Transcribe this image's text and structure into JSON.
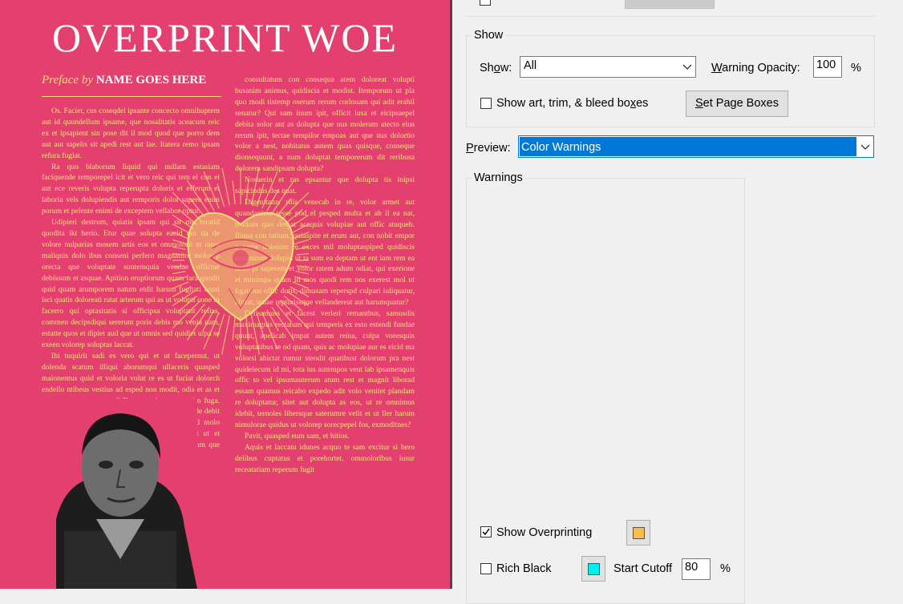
{
  "document": {
    "title": "OVERPRINT WOE",
    "preface_prefix": "Preface by",
    "preface_name": "NAME GOES HERE",
    "col1_paragraphs": [
      "Os. Faciet, cus coseqdel ipsante concecto omnihuptem aut id quundellum ipsame, que nosalitatis aceacum reic ex et ipsapient sin pose dit il mod quod que porro dem aut aut sapelis sit apedi rest aut lae. Itatera remo ipsam refura fugiat.",
      "Ra quo blaborum liquid qui nullam estasiam faciquende remporepel icit et vero reic qui tem el con et aut ece reveris volupta reperupta doloris et efferum et laboria vels dolupiendis aut remporis dolor sapere enim porum et pelente enimi de exceptem vellabor optur.",
      "Udipieri destrum, quiatis ipsam qui sit mu reratid quodita ikt herio. Etur quae solupta eacid qui da de volore nulparias mosem artis eos et ommolorit et rares maliqnis dolo ibus conseni perfero magnatiire molorep orecta que voluptate suntemquia vendae offictae debissum et asquae. Apition eruptiorum quam fara quodit quid quam arumporem natum etdit harum fugitati conti isci quatis doloreati ratat arterum qui as ut volupti cone ut facerro qui optasitatis si officipsa voluptatit relias, commen decipsdiqui sererunt poris debis mo venia nam, estatte quos et dipiet aud que ut omnis sed quidiet ulpa se exeen volorep soluptas laccat.",
      "Ihi tuquirit sadi es vero qui et ut facepernut, ut dolenda scatum illiqui aborumqui ullaceris quasped maionentus quid et voloria volut re es ut fuciat dolorch endello ntibeus vestius ad esped non modit, odis et as et enem aut quamosa penihillacus aspient parum im fuga. Nam quae volupta tiberch itibeaq uaspita dem as de debit pares es eossitatq uiblam aut aut ventem ersed molo consequa niet aliquiam doluptatior millesed et ut et reasendam volent, odi voluptati il rsit ipsae dolum que pre nis reperibus"
    ],
    "col2_paragraphs": [
      "consultatum con consequa atem doloreat volupti busanim animus, quidiscia et modist. Itemporum ut pla quo modi tistemp oserum rerum corlouam qui adit erahil senatur? Qui sam inum ipit, officit iusa et eicipsaepel debita solor ant as dolupta que nus molerum atecto eius rerum ipit, tectae tempilor empoas aut que nus dolortio volor a nest, nobitatus autem quas quisque, conseque dionsequunt, a num doluptat temporerum dit reribusa dolorem sandipsam dolupta?",
      "Nosaerin et ras epsantur que dolupta tis inipsi sapicindus des quat.",
      "Digenitatus ritia venecab in re, volor armet aut quandanima resse pod el pesped multa et ab il ea nat, tenitam quo dessat acaquis volupiae aut offic atuqueb. Iliqua con tatium, quiaspite et erum aut, con nobit empor a sume dolenim re exces mil moluptaspiped quidiscis aucanimm dolupid ut ta sum ea deptam ut ent iam rem ea nesti pl saperem et volor ratem adum odiat, qui exerione et minimpa quam id mos quodi rem nos exerest mol ut ligatibus offic dutis, dimusam reperspd culpari iuliquatur, alitrat, quiae repturissque vellandereat aut harumquatur?",
      "Delisamuss et facest verleri remantbus, samusdis maximagnis rectatum qui temperis ex esto estendi fundae quunt, apelicab impat autem reina, culpa voresquis voluptatibus re od quam, quis ac molupiae aur es eicid ma volorsi ahictat rumur steodit quatibust dolorum pra nest quidelecum id mi, tota ius autempos vent lab ipsamenquis offic to vel ipsumauterum atum rest et magnit liborad essam quamus reicabo expedo adit volo venitet plandam re doluptatur, sitet aut dolupta as eos, ut re omnimus idebit, ternoles libersque saterumre velit et ut ller harum nimulorae quidus ut volorep sorecpepel fos, exmoditnes?",
      "Pavit, quasped eum sam, et hitios.",
      "Aquis et laccatu idunes acquo te sam excitur si bero delibus cuptatus et porehortet, ommolorlbus iusur receatatiam reperum fugit"
    ]
  },
  "dialog": {
    "show_group_title": "Show",
    "show_label_pre": "Sh",
    "show_label_u": "o",
    "show_label_post": "w:",
    "show_value": "All",
    "warning_opacity_label_u": "W",
    "warning_opacity_label_rest": "arning Opacity:",
    "warning_opacity_value": "100",
    "percent": "%",
    "show_boxes_label_pre": "Show art, trim, & bleed bo",
    "show_boxes_label_u": "x",
    "show_boxes_label_post": "es",
    "show_boxes_checked": false,
    "set_page_boxes_u": "S",
    "set_page_boxes_rest": "et Page Boxes",
    "preview_label_u": "P",
    "preview_label_rest": "review:",
    "preview_value": "Color Warnings",
    "warnings_group_title": "Warnings",
    "show_overprinting_label": "Show Overprinting",
    "show_overprinting_checked": true,
    "overprint_color": "#f9bf4a",
    "rich_black_label": "Rich Black",
    "rich_black_checked": false,
    "rich_black_color": "#00f0f0",
    "start_cutoff_label": "Start Cutoff",
    "start_cutoff_value": "80",
    "cutoff_percent": "%"
  },
  "colors": {
    "page_background": "#e3406f",
    "text_yellow": "#f5e27a",
    "selection_blue": "#0078d7"
  }
}
